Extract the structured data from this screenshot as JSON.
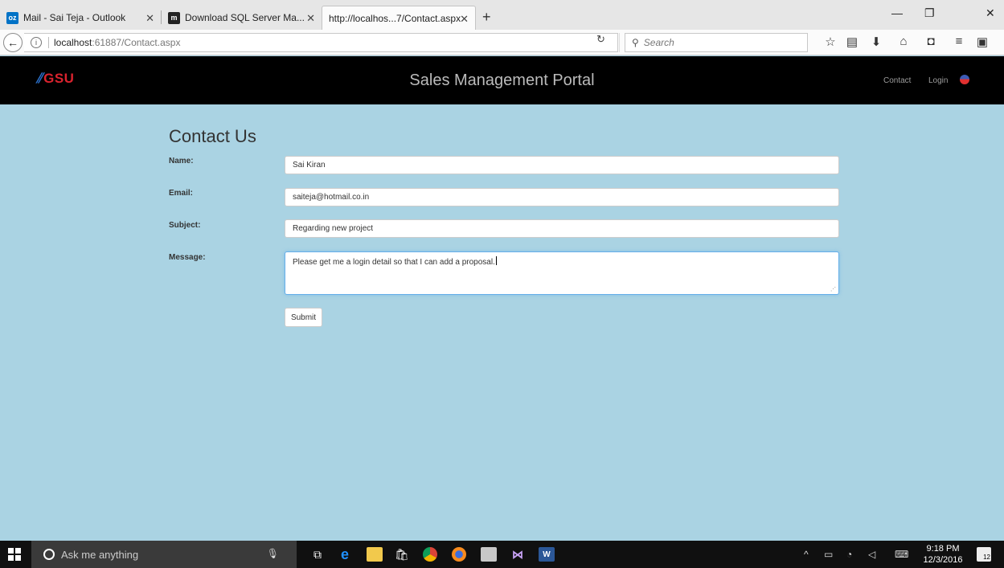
{
  "browser": {
    "tabs": [
      {
        "label": "Mail - Sai Teja - Outlook",
        "icon": "outlook-icon",
        "icon_text": "oz",
        "icon_color": "#0072c6"
      },
      {
        "label": "Download SQL Server Ma...",
        "icon": "m-site-icon",
        "icon_text": "m",
        "icon_color": "#222222"
      },
      {
        "label": "http://localhos...7/Contact.aspx",
        "icon": "",
        "icon_text": "",
        "icon_color": ""
      }
    ],
    "url_host": "localhost",
    "url_rest": ":61887/Contact.aspx",
    "search_placeholder": "Search"
  },
  "site": {
    "logo_text": "GSU",
    "title": "Sales Management Portal",
    "nav": {
      "contact": "Contact",
      "login": "Login"
    },
    "accent_color": "#d9232e"
  },
  "form": {
    "heading": "Contact Us",
    "name_label": "Name:",
    "name_value": "Sai Kiran",
    "email_label": "Email:",
    "email_value": "saiteja@hotmail.co.in",
    "subject_label": "Subject:",
    "subject_value": "Regarding new project",
    "message_label": "Message:",
    "message_value": "Please get me a login detail so that I can add a proposal.",
    "submit_label": "Submit"
  },
  "taskbar": {
    "search_text": "Ask me anything",
    "time": "9:18 PM",
    "date": "12/3/2016",
    "notification_count": "12"
  }
}
